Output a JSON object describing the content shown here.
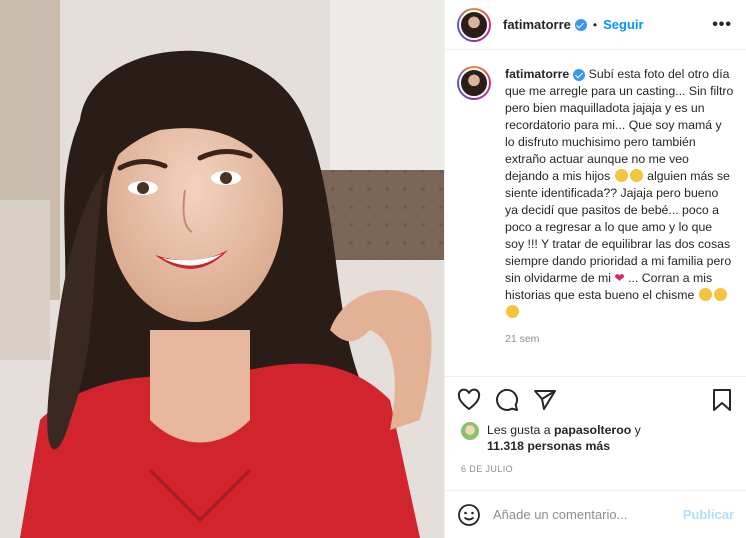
{
  "header": {
    "username": "fatimatorre",
    "separator": "•",
    "follow_label": "Seguir",
    "more_label": "•••"
  },
  "caption": {
    "username": "fatimatorre",
    "text_1": "Subí esta foto del otro día que me arregle para un casting... Sin filtro pero bien maquilladota jajaja y es un recordatorio para mi... Que soy mamá y lo disfruto muchisimo pero también extraño actuar aunque no me veo dejando a mis hijos",
    "text_2": "alguien más se siente identificada?? Jajaja pero bueno ya decidí que pasitos de bebé... poco a poco a regresar a lo que amo y lo que soy !!! Y tratar de equilibrar las dos cosas siempre dando prioridad a mi familia pero sin olvidarme de mi",
    "text_3": "... Corran a mis historias que esta bueno el chisme",
    "heart": "❤",
    "time": "21 sem"
  },
  "likes": {
    "prefix": "Les gusta a",
    "user": "papasolteroo",
    "connector": "y",
    "count": "11.318 personas más"
  },
  "date": "6 DE JULIO",
  "comment": {
    "placeholder": "Añade un comentario...",
    "publish_label": "Publicar"
  },
  "icons": {
    "like": "heart-icon",
    "comment": "comment-icon",
    "share": "share-icon",
    "save": "bookmark-icon",
    "emoji": "smiley-icon"
  },
  "colors": {
    "accent": "#0095f6",
    "verified": "#3897f0",
    "publish_disabled": "#b2dffc",
    "muted": "#8e8e8e"
  }
}
